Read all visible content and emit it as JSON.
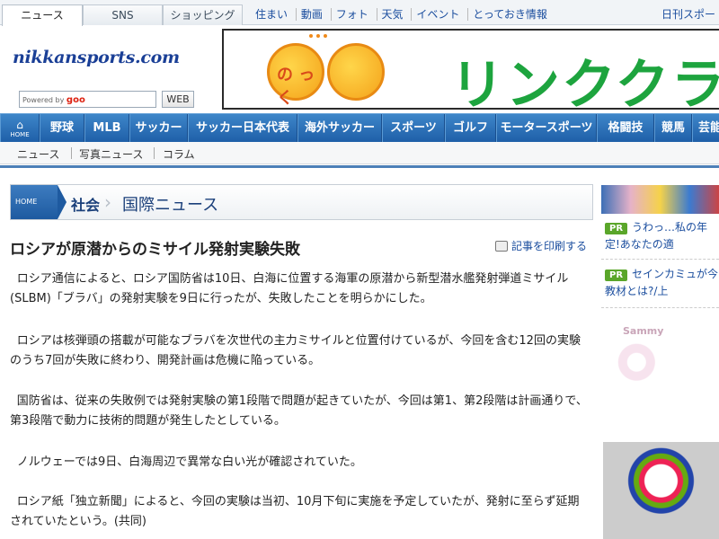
{
  "tabs": [
    "ニュース",
    "SNS",
    "ショッピング"
  ],
  "top_links": [
    "住まい",
    "動画",
    "フォト",
    "天気",
    "イベント",
    "とっておき情報"
  ],
  "brand_link": "日刊スポー",
  "logo": "nikkansports.com",
  "search": {
    "powered_by": "Powered by",
    "goo": "goo",
    "button": "WEB"
  },
  "banner": {
    "badge_text": "の っ く",
    "text": "リンククラブ"
  },
  "main_nav": {
    "home": "HOME",
    "items": [
      "野球",
      "MLB",
      "サッカー",
      "サッカー日本代表",
      "海外サッカー",
      "スポーツ",
      "ゴルフ",
      "モータースポーツ",
      "格闘技",
      "競馬",
      "芸能"
    ]
  },
  "sub_nav": [
    "ニュース",
    "写真ニュース",
    "コラム"
  ],
  "breadcrumb": {
    "home": "HOME",
    "category": "社会",
    "subcategory": "国際ニュース"
  },
  "article": {
    "headline": "ロシアが原潜からのミサイル発射実験失敗",
    "print_label": "記事を印刷する",
    "paragraphs": [
      "ロシア通信によると、ロシア国防省は10日、白海に位置する海軍の原潜から新型潜水艦発射弾道ミサイル(SLBM)「ブラバ」の発射実験を9日に行ったが、失敗したことを明らかにした。",
      "ロシアは核弾頭の搭載が可能なブラバを次世代の主力ミサイルと位置付けているが、今回を含む12回の実験のうち7回が失敗に終わり、開発計画は危機に陥っている。",
      "国防省は、従来の失敗例では発射実験の第1段階で問題が起きていたが、今回は第1、第2段階は計画通りで、第3段階で動力に技術的問題が発生したとしている。",
      "ノルウェーでは9日、白海周辺で異常な白い光が確認されていた。",
      "ロシア紙「独立新聞」によると、今回の実験は当初、10月下旬に実施を予定していたが、発射に至らず延期されていたという。(共同)"
    ]
  },
  "sidebar": {
    "pr_items": [
      {
        "badge": "PR",
        "text": "うわっ…私の年定!あなたの適"
      },
      {
        "badge": "PR",
        "text": "セインカミュが今教材とは?/上"
      }
    ],
    "ad_label": "Sammy"
  },
  "colors": {
    "nav_blue": "#2a6db5",
    "link_blue": "#1a4d9e",
    "banner_green": "#1da43e",
    "pr_green": "#5aa62a"
  }
}
